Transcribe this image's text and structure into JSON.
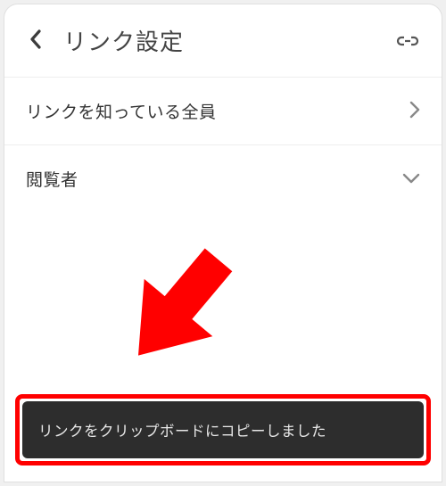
{
  "header": {
    "title": "リンク設定"
  },
  "rows": {
    "access": {
      "label": "リンクを知っている全員"
    },
    "role": {
      "label": "閲覧者"
    }
  },
  "toast": {
    "message": "リンクをクリップボードにコピーしました"
  }
}
